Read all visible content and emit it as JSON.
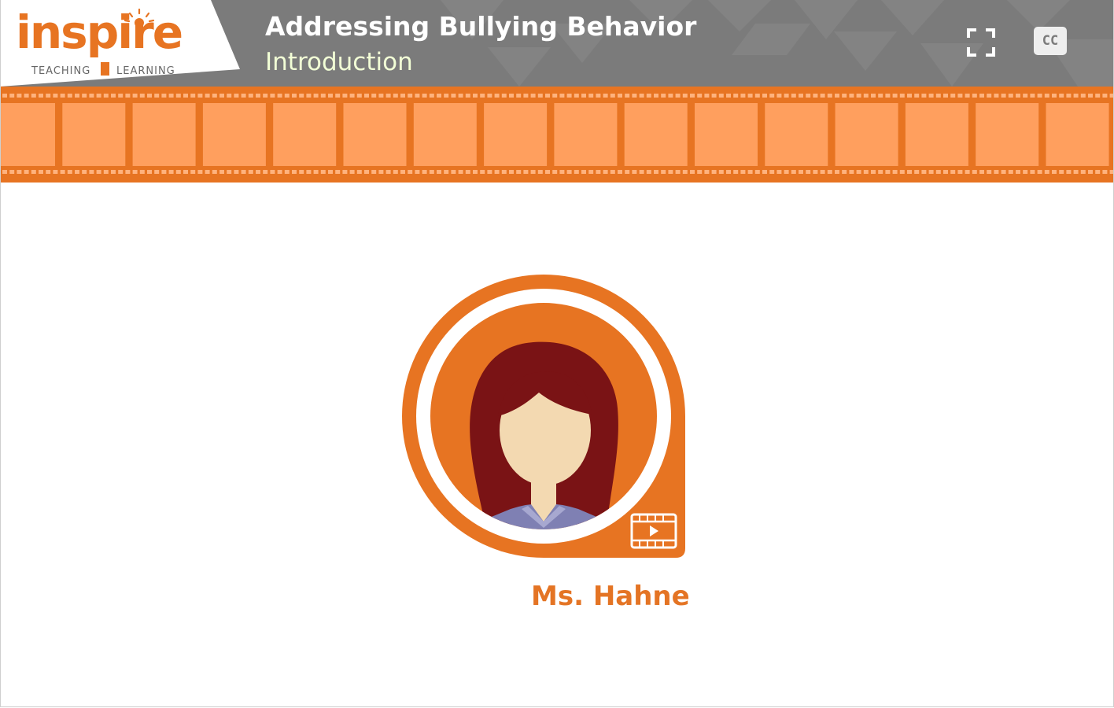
{
  "brand": {
    "logo_text": "inspire",
    "logo_sub_left": "TEACHING",
    "logo_sub_right": "LEARNING"
  },
  "header": {
    "title": "Addressing Bullying Behavior",
    "subtitle": "Introduction",
    "fullscreen_icon": "fullscreen-icon",
    "cc_label": "CC"
  },
  "content": {
    "presenter_name": "Ms. Hahne",
    "video_icon": "film-play-icon"
  },
  "colors": {
    "accent_orange": "#e77422",
    "film_cell": "#ff9f5e",
    "header_gray": "#7b7b7b",
    "subtitle_green": "#f2ffd6",
    "hair": "#7a1315",
    "skin": "#f3d9b1",
    "shirt": "#7f80b3"
  }
}
